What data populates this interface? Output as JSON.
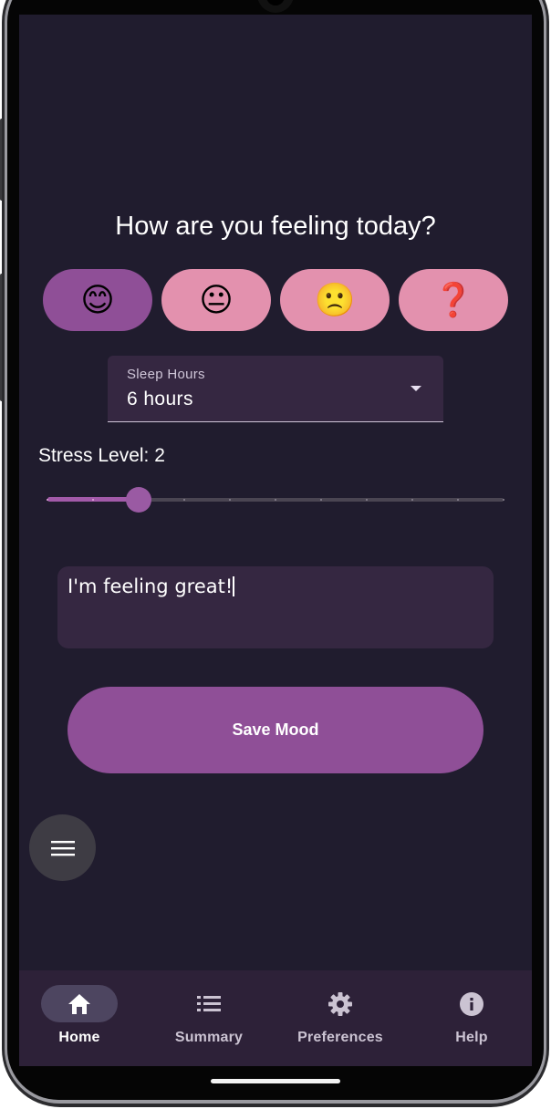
{
  "screen": {
    "question": "How are you feeling today?"
  },
  "moods": [
    {
      "emoji": "😊",
      "name": "happy",
      "selected": true
    },
    {
      "emoji": "😐",
      "name": "neutral",
      "selected": false
    },
    {
      "emoji": "🙁",
      "name": "sad",
      "selected": false
    },
    {
      "emoji": "❓",
      "name": "unsure",
      "selected": false
    }
  ],
  "sleep": {
    "label": "Sleep Hours",
    "value": "6 hours"
  },
  "stress": {
    "label": "Stress Level: 2",
    "value": 2,
    "min": 0,
    "max": 10
  },
  "note": {
    "value": "I'm feeling great!"
  },
  "save_button": {
    "label": "Save Mood"
  },
  "nav": [
    {
      "label": "Home",
      "icon": "home-icon",
      "active": true
    },
    {
      "label": "Summary",
      "icon": "list-icon",
      "active": false
    },
    {
      "label": "Preferences",
      "icon": "gear-icon",
      "active": false
    },
    {
      "label": "Help",
      "icon": "info-icon",
      "active": false
    }
  ],
  "colors": {
    "background": "#201c2e",
    "accent": "#8f4f97",
    "mood_unselected": "#e391ae",
    "field": "#352741",
    "nav_bar": "#2d2138"
  }
}
